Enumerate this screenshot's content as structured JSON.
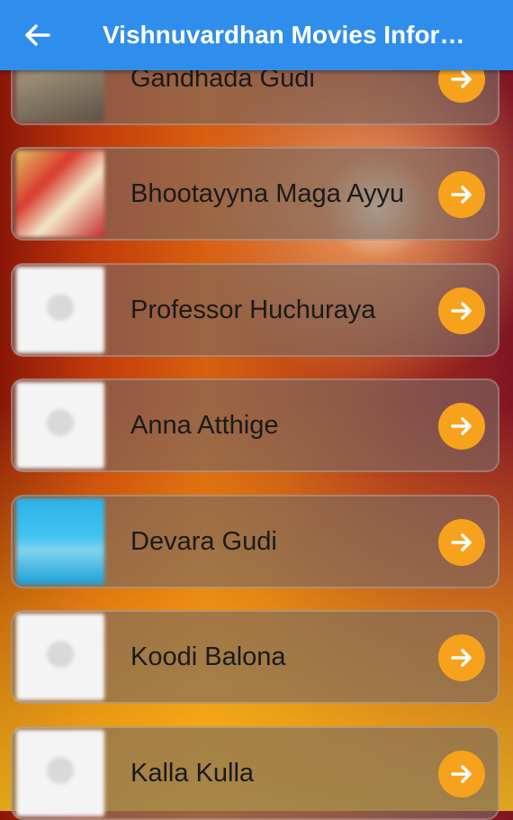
{
  "app_bar": {
    "title": "Vishnuvardhan Movies Infor…",
    "back_icon": "arrow-left-icon",
    "color": "#2f8eeb"
  },
  "movies": [
    {
      "title": "Gandhada Gudi",
      "thumbnail": "photo"
    },
    {
      "title": "Bhootayyna Maga Ayyu",
      "thumbnail": "photo"
    },
    {
      "title": "Professor Huchuraya",
      "thumbnail": "placeholder"
    },
    {
      "title": "Anna Atthige",
      "thumbnail": "placeholder"
    },
    {
      "title": "Devara Gudi",
      "thumbnail": "photo"
    },
    {
      "title": "Koodi Balona",
      "thumbnail": "placeholder"
    },
    {
      "title": "Kalla Kulla",
      "thumbnail": "placeholder"
    }
  ],
  "item_action_icon": "arrow-right-icon",
  "accent_color": "#f6a21c"
}
